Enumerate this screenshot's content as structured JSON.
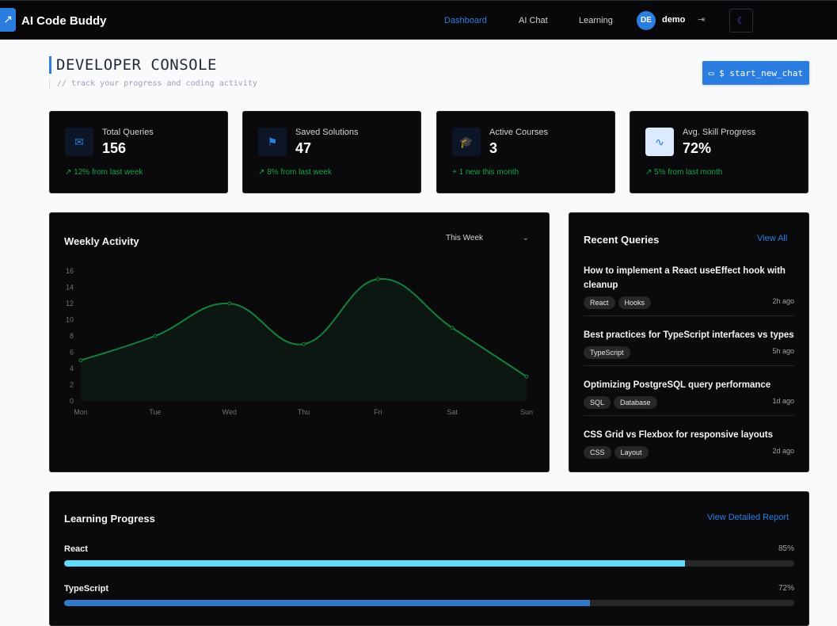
{
  "nav": {
    "brand": "AI Code Buddy",
    "links": [
      {
        "label": "Dashboard",
        "active": true
      },
      {
        "label": "AI Chat",
        "active": false
      },
      {
        "label": "Learning",
        "active": false
      }
    ],
    "avatar_initials": "DE",
    "username": "demo",
    "logout_icon": "logout-icon",
    "theme_icon": "moon-icon"
  },
  "header": {
    "title": "DEVELOPER CONSOLE",
    "subtitle": "// track your progress and coding activity",
    "new_chat_label": "$ start_new_chat"
  },
  "stats": [
    {
      "label": "Total Queries",
      "value": "156",
      "delta": "12% from last week",
      "icon": "message-icon",
      "delta_icon": "trending-up-icon"
    },
    {
      "label": "Saved Solutions",
      "value": "47",
      "delta": "8% from last week",
      "icon": "bookmark-icon",
      "delta_icon": "trending-up-icon"
    },
    {
      "label": "Active Courses",
      "value": "3",
      "delta": "1 new this month",
      "icon": "graduation-cap-icon",
      "delta_icon": "plus-icon"
    },
    {
      "label": "Avg. Skill Progress",
      "value": "72%",
      "delta": "5% from last month",
      "icon": "activity-icon",
      "delta_icon": "trending-up-icon"
    }
  ],
  "weekly": {
    "title": "Weekly Activity",
    "range_select": "This Week"
  },
  "chart_data": {
    "type": "area",
    "categories": [
      "Mon",
      "Tue",
      "Wed",
      "Thu",
      "Fri",
      "Sat",
      "Sun"
    ],
    "values": [
      5,
      8,
      12,
      7,
      15,
      9,
      3
    ],
    "ylim": [
      0,
      16
    ],
    "yticks": [
      "0",
      "2",
      "4",
      "6",
      "8",
      "10",
      "12",
      "14",
      "16"
    ],
    "grid": false,
    "line_color": "#15803d"
  },
  "recent": {
    "title": "Recent Queries",
    "view_all": "View All",
    "items": [
      {
        "title": "How to implement a React useEffect hook with cleanup",
        "tags": [
          "React",
          "Hooks"
        ],
        "time": "2h ago"
      },
      {
        "title": "Best practices for TypeScript interfaces vs types",
        "tags": [
          "TypeScript"
        ],
        "time": "5h ago"
      },
      {
        "title": "Optimizing PostgreSQL query performance",
        "tags": [
          "SQL",
          "Database"
        ],
        "time": "1d ago"
      },
      {
        "title": "CSS Grid vs Flexbox for responsive layouts",
        "tags": [
          "CSS",
          "Layout"
        ],
        "time": "2d ago"
      }
    ]
  },
  "learning": {
    "title": "Learning Progress",
    "report_link": "View Detailed Report",
    "items": [
      {
        "label": "React",
        "pct_text": "85%",
        "pct": 85,
        "color": "#61dafb"
      },
      {
        "label": "TypeScript",
        "pct_text": "72%",
        "pct": 72,
        "color": "#3178c6"
      }
    ]
  },
  "colors": {
    "accent": "#2b7de0",
    "positive": "#16a34a"
  }
}
